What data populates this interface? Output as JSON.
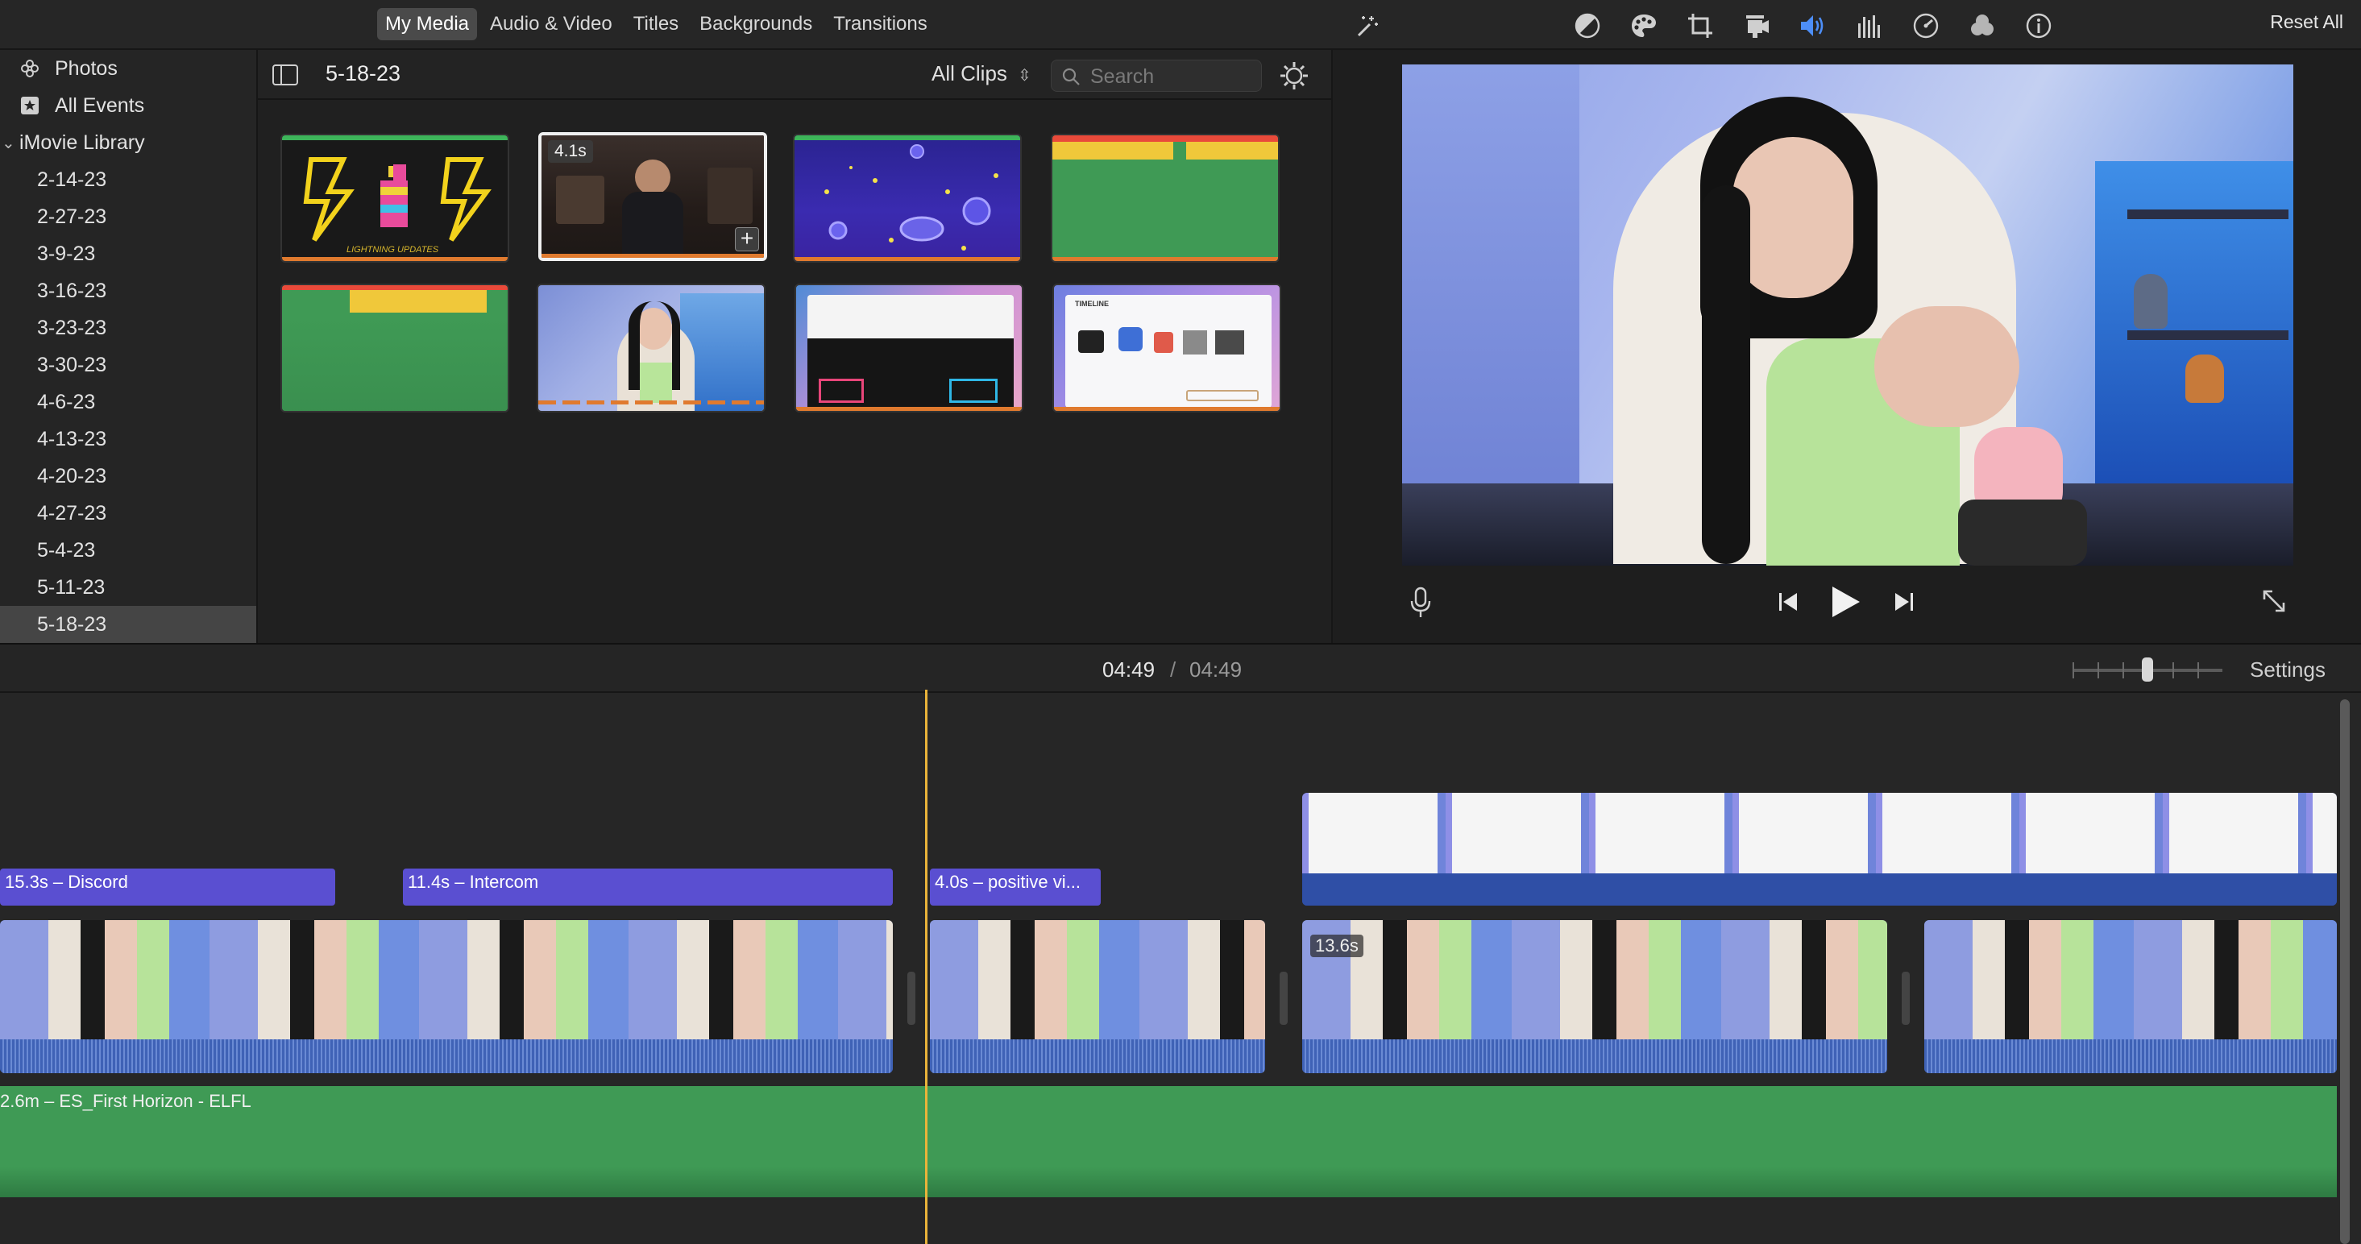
{
  "media_tabs": [
    {
      "label": "My Media",
      "active": true
    },
    {
      "label": "Audio & Video"
    },
    {
      "label": "Titles"
    },
    {
      "label": "Backgrounds"
    },
    {
      "label": "Transitions"
    }
  ],
  "sidebar": {
    "photos": "Photos",
    "all_events": "All Events",
    "library": "iMovie Library",
    "events": [
      "2-14-23",
      "2-27-23",
      "3-9-23",
      "3-16-23",
      "3-23-23",
      "3-30-23",
      "4-6-23",
      "4-13-23",
      "4-20-23",
      "4-27-23",
      "5-4-23",
      "5-11-23",
      "5-18-23"
    ],
    "selected_event": "5-18-23"
  },
  "browser": {
    "event_title": "5-18-23",
    "clip_filter": "All Clips",
    "search_placeholder": "Search",
    "selected_thumb_duration": "4.1s",
    "thumb_banner_text": "LIGHTNING UPDATES",
    "thumb_timeline_text": "TIMELINE"
  },
  "viewer": {
    "reset_all": "Reset All"
  },
  "timeline": {
    "current_time": "04:49",
    "separator": "/",
    "total_time": "04:49",
    "settings_label": "Settings",
    "title_clips": [
      {
        "label": "15.3s – Discord"
      },
      {
        "label": "11.4s – Intercom"
      },
      {
        "label": "4.0s – positive vi..."
      }
    ],
    "video_clip_duration": "13.6s",
    "music_label": "2.6m – ES_First Horizon - ELFL"
  },
  "colors": {
    "title_clip": "#5a4fd1",
    "video_clip": "#3a5aa8",
    "music_clip": "#3f9a55",
    "playhead": "#e9b33a",
    "active_icon": "#4d8ef7"
  }
}
